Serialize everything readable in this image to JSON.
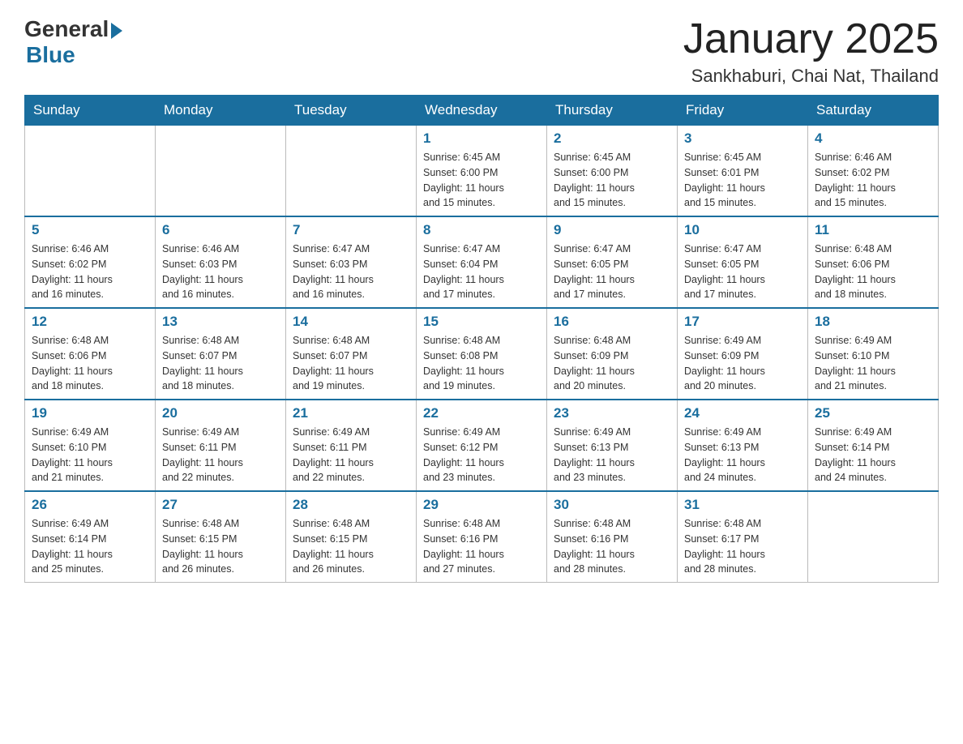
{
  "header": {
    "logo_general": "General",
    "logo_blue": "Blue",
    "title": "January 2025",
    "location": "Sankhaburi, Chai Nat, Thailand"
  },
  "days_of_week": [
    "Sunday",
    "Monday",
    "Tuesday",
    "Wednesday",
    "Thursday",
    "Friday",
    "Saturday"
  ],
  "weeks": [
    [
      {
        "day": "",
        "info": ""
      },
      {
        "day": "",
        "info": ""
      },
      {
        "day": "",
        "info": ""
      },
      {
        "day": "1",
        "info": "Sunrise: 6:45 AM\nSunset: 6:00 PM\nDaylight: 11 hours\nand 15 minutes."
      },
      {
        "day": "2",
        "info": "Sunrise: 6:45 AM\nSunset: 6:00 PM\nDaylight: 11 hours\nand 15 minutes."
      },
      {
        "day": "3",
        "info": "Sunrise: 6:45 AM\nSunset: 6:01 PM\nDaylight: 11 hours\nand 15 minutes."
      },
      {
        "day": "4",
        "info": "Sunrise: 6:46 AM\nSunset: 6:02 PM\nDaylight: 11 hours\nand 15 minutes."
      }
    ],
    [
      {
        "day": "5",
        "info": "Sunrise: 6:46 AM\nSunset: 6:02 PM\nDaylight: 11 hours\nand 16 minutes."
      },
      {
        "day": "6",
        "info": "Sunrise: 6:46 AM\nSunset: 6:03 PM\nDaylight: 11 hours\nand 16 minutes."
      },
      {
        "day": "7",
        "info": "Sunrise: 6:47 AM\nSunset: 6:03 PM\nDaylight: 11 hours\nand 16 minutes."
      },
      {
        "day": "8",
        "info": "Sunrise: 6:47 AM\nSunset: 6:04 PM\nDaylight: 11 hours\nand 17 minutes."
      },
      {
        "day": "9",
        "info": "Sunrise: 6:47 AM\nSunset: 6:05 PM\nDaylight: 11 hours\nand 17 minutes."
      },
      {
        "day": "10",
        "info": "Sunrise: 6:47 AM\nSunset: 6:05 PM\nDaylight: 11 hours\nand 17 minutes."
      },
      {
        "day": "11",
        "info": "Sunrise: 6:48 AM\nSunset: 6:06 PM\nDaylight: 11 hours\nand 18 minutes."
      }
    ],
    [
      {
        "day": "12",
        "info": "Sunrise: 6:48 AM\nSunset: 6:06 PM\nDaylight: 11 hours\nand 18 minutes."
      },
      {
        "day": "13",
        "info": "Sunrise: 6:48 AM\nSunset: 6:07 PM\nDaylight: 11 hours\nand 18 minutes."
      },
      {
        "day": "14",
        "info": "Sunrise: 6:48 AM\nSunset: 6:07 PM\nDaylight: 11 hours\nand 19 minutes."
      },
      {
        "day": "15",
        "info": "Sunrise: 6:48 AM\nSunset: 6:08 PM\nDaylight: 11 hours\nand 19 minutes."
      },
      {
        "day": "16",
        "info": "Sunrise: 6:48 AM\nSunset: 6:09 PM\nDaylight: 11 hours\nand 20 minutes."
      },
      {
        "day": "17",
        "info": "Sunrise: 6:49 AM\nSunset: 6:09 PM\nDaylight: 11 hours\nand 20 minutes."
      },
      {
        "day": "18",
        "info": "Sunrise: 6:49 AM\nSunset: 6:10 PM\nDaylight: 11 hours\nand 21 minutes."
      }
    ],
    [
      {
        "day": "19",
        "info": "Sunrise: 6:49 AM\nSunset: 6:10 PM\nDaylight: 11 hours\nand 21 minutes."
      },
      {
        "day": "20",
        "info": "Sunrise: 6:49 AM\nSunset: 6:11 PM\nDaylight: 11 hours\nand 22 minutes."
      },
      {
        "day": "21",
        "info": "Sunrise: 6:49 AM\nSunset: 6:11 PM\nDaylight: 11 hours\nand 22 minutes."
      },
      {
        "day": "22",
        "info": "Sunrise: 6:49 AM\nSunset: 6:12 PM\nDaylight: 11 hours\nand 23 minutes."
      },
      {
        "day": "23",
        "info": "Sunrise: 6:49 AM\nSunset: 6:13 PM\nDaylight: 11 hours\nand 23 minutes."
      },
      {
        "day": "24",
        "info": "Sunrise: 6:49 AM\nSunset: 6:13 PM\nDaylight: 11 hours\nand 24 minutes."
      },
      {
        "day": "25",
        "info": "Sunrise: 6:49 AM\nSunset: 6:14 PM\nDaylight: 11 hours\nand 24 minutes."
      }
    ],
    [
      {
        "day": "26",
        "info": "Sunrise: 6:49 AM\nSunset: 6:14 PM\nDaylight: 11 hours\nand 25 minutes."
      },
      {
        "day": "27",
        "info": "Sunrise: 6:48 AM\nSunset: 6:15 PM\nDaylight: 11 hours\nand 26 minutes."
      },
      {
        "day": "28",
        "info": "Sunrise: 6:48 AM\nSunset: 6:15 PM\nDaylight: 11 hours\nand 26 minutes."
      },
      {
        "day": "29",
        "info": "Sunrise: 6:48 AM\nSunset: 6:16 PM\nDaylight: 11 hours\nand 27 minutes."
      },
      {
        "day": "30",
        "info": "Sunrise: 6:48 AM\nSunset: 6:16 PM\nDaylight: 11 hours\nand 28 minutes."
      },
      {
        "day": "31",
        "info": "Sunrise: 6:48 AM\nSunset: 6:17 PM\nDaylight: 11 hours\nand 28 minutes."
      },
      {
        "day": "",
        "info": ""
      }
    ]
  ]
}
